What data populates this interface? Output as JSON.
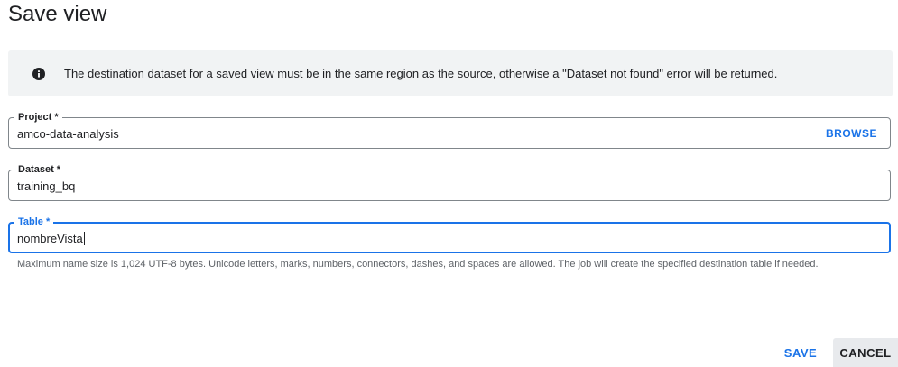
{
  "dialog": {
    "title": "Save view"
  },
  "banner": {
    "icon": "info-icon",
    "message": "The destination dataset for a saved view must be in the same region as the source, otherwise a \"Dataset not found\" error will be returned."
  },
  "fields": {
    "project": {
      "label": "Project *",
      "value": "amco-data-analysis",
      "browse_label": "BROWSE"
    },
    "dataset": {
      "label": "Dataset *",
      "value": "training_bq"
    },
    "table": {
      "label": "Table *",
      "value": "nombreVista",
      "focused": true
    }
  },
  "hint": "Maximum name size is 1,024 UTF-8 bytes. Unicode letters, marks, numbers, connectors, dashes, and spaces are allowed. The job will create the specified destination table if needed.",
  "actions": {
    "save_label": "SAVE",
    "cancel_label": "CANCEL"
  },
  "colors": {
    "accent": "#1a73e8",
    "banner_bg": "#f1f3f4",
    "text": "#202124",
    "muted": "#5f6368"
  }
}
